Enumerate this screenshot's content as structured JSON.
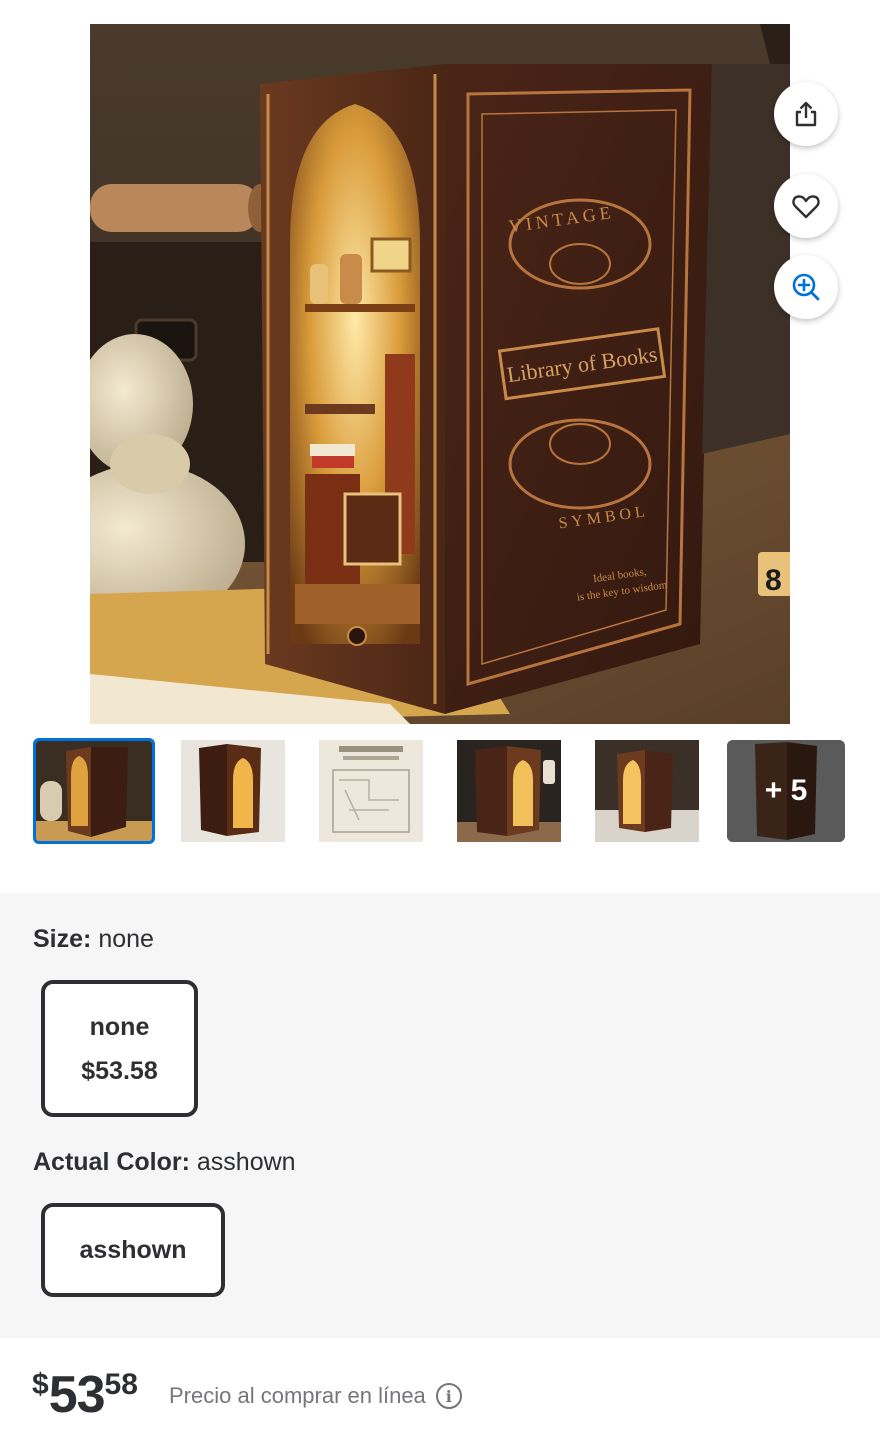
{
  "product_image": {
    "box_title": "Library of Books",
    "arc_top": "VINTAGE",
    "arc_bottom": "SYMBOL",
    "tagline_1": "Ideal books,",
    "tagline_2": "is the key to wisdom",
    "die_face": "8"
  },
  "actions": {
    "share_icon": "share-icon",
    "favorite_icon": "heart-icon",
    "zoom_icon": "zoom-in-icon"
  },
  "thumbnails": {
    "count_shown": 5,
    "more_label": "+ 5"
  },
  "size": {
    "label": "Size:",
    "value": "none",
    "options": [
      {
        "name": "none",
        "price": "$53.58"
      }
    ]
  },
  "color": {
    "label": "Actual Color:",
    "value": "asshown",
    "options": [
      {
        "name": "asshown"
      }
    ]
  },
  "price": {
    "currency": "$",
    "dollars": "53",
    "cents": "58",
    "note": "Precio al comprar en línea",
    "info_icon": "info-icon"
  },
  "colors": {
    "accent": "#0071dc",
    "chip_border": "#2e2f32",
    "panel_bg": "#f6f6f6"
  }
}
